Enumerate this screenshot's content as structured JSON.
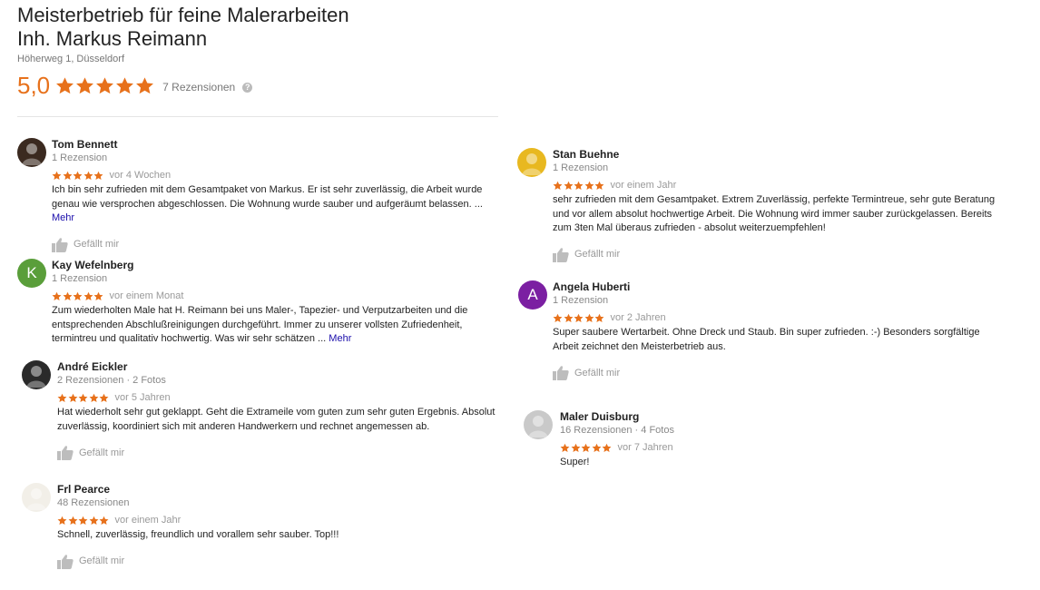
{
  "business": {
    "title_line1": "Meisterbetrieb für feine Malerarbeiten",
    "title_line2": "Inh. Markus Reimann",
    "address": "Höherweg 1, Düsseldorf",
    "rating": "5,0",
    "stars": 5,
    "review_count": "7 Rezensionen",
    "help_glyph": "?"
  },
  "colors": {
    "star": "#e7711b",
    "link": "#1a0dab"
  },
  "reviews": [
    {
      "name": "Tom Bennett",
      "meta": "1 Rezension",
      "date": "vor 4 Wochen",
      "text": "Ich bin sehr zufrieden mit dem Gesamtpaket von Markus. Er ist sehr zuverlässig, die Arbeit wurde genau wie versprochen abgeschlossen. Die Wohnung wurde sauber und aufgeräumt belassen. ...",
      "more": "Mehr",
      "like": "Gefällt mir",
      "avatar_letter": "",
      "avatar_color": "#3b2a20"
    },
    {
      "name": "Kay Wefelnberg",
      "meta": "1 Rezension",
      "date": "vor einem Monat",
      "text": "Zum wiederholten Male hat H. Reimann bei uns Maler-, Tapezier- und Verputzarbeiten und die entsprechenden Abschlußreinigungen durchgeführt. Immer zu unserer vollsten Zufriedenheit, termintreu und qualitativ hochwertig. Was wir sehr schätzen ...",
      "more": "Mehr",
      "like": "",
      "avatar_letter": "K",
      "avatar_color": "#5a9e3a"
    },
    {
      "name": "André Eickler",
      "meta": "2 Rezensionen · 2 Fotos",
      "date": "vor 5 Jahren",
      "text": "Hat wiederholt sehr gut geklappt. Geht die Extrameile vom guten zum sehr guten Ergebnis. Absolut zuverlässig, koordiniert sich mit anderen Handwerkern und rechnet angemessen ab.",
      "more": "",
      "like": "Gefällt mir",
      "avatar_letter": "",
      "avatar_color": "#2a2a2a"
    },
    {
      "name": "Frl Pearce",
      "meta": "48 Rezensionen",
      "date": "vor einem Jahr",
      "text": "Schnell, zuverlässig, freundlich und vorallem sehr sauber. Top!!!",
      "more": "",
      "like": "Gefällt mir",
      "avatar_letter": "",
      "avatar_color": "#f2efe8"
    },
    {
      "name": "Stan Buehne",
      "meta": "1 Rezension",
      "date": "vor einem Jahr",
      "text": "sehr zufrieden mit dem Gesamtpaket. Extrem Zuverlässig, perfekte Termintreue, sehr gute Beratung und vor allem absolut hochwertige Arbeit. Die Wohnung wird immer sauber zurückgelassen. Bereits zum 3ten Mal überaus zufrieden - absolut weiterzuempfehlen!",
      "more": "",
      "like": "Gefällt mir",
      "avatar_letter": "",
      "avatar_color": "#e8b820"
    },
    {
      "name": "Angela Huberti",
      "meta": "1 Rezension",
      "date": "vor 2 Jahren",
      "text": "Super saubere Wertarbeit. Ohne Dreck und Staub. Bin super zufrieden. :-) Besonders sorgfältige Arbeit zeichnet den Meisterbetrieb aus.",
      "more": "",
      "like": "Gefällt mir",
      "avatar_letter": "A",
      "avatar_color": "#7b1fa2"
    },
    {
      "name": "Maler Duisburg",
      "meta": "16 Rezensionen · 4 Fotos",
      "date": "vor 7 Jahren",
      "text": "Super!",
      "more": "",
      "like": "",
      "avatar_letter": "",
      "avatar_color": "#c9c9c9"
    }
  ]
}
